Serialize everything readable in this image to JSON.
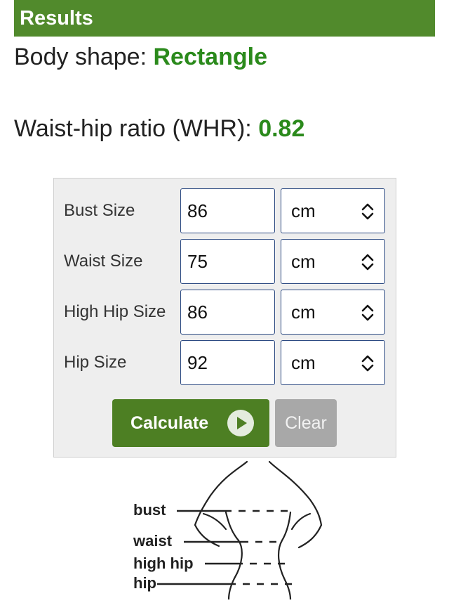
{
  "header": {
    "title": "Results"
  },
  "results": {
    "shape_label": "Body shape: ",
    "shape_value": "Rectangle",
    "whr_label": "Waist-hip ratio (WHR): ",
    "whr_value": "0.82"
  },
  "form": {
    "rows": [
      {
        "label": "Bust Size",
        "value": "86",
        "unit": "cm"
      },
      {
        "label": "Waist Size",
        "value": "75",
        "unit": "cm"
      },
      {
        "label": "High Hip Size",
        "value": "86",
        "unit": "cm"
      },
      {
        "label": "Hip Size",
        "value": "92",
        "unit": "cm"
      }
    ],
    "calculate_label": "Calculate",
    "clear_label": "Clear"
  },
  "diagram": {
    "labels": [
      "bust",
      "waist",
      "high hip",
      "hip"
    ]
  },
  "colors": {
    "header_bg": "#518a2c",
    "result_value": "#2b8a1c",
    "calculate_bg": "#4d7f23",
    "clear_bg": "#a8a8a8"
  },
  "icons": {
    "unit_select": "chevron-up-down-icon",
    "calculate": "play-icon"
  }
}
